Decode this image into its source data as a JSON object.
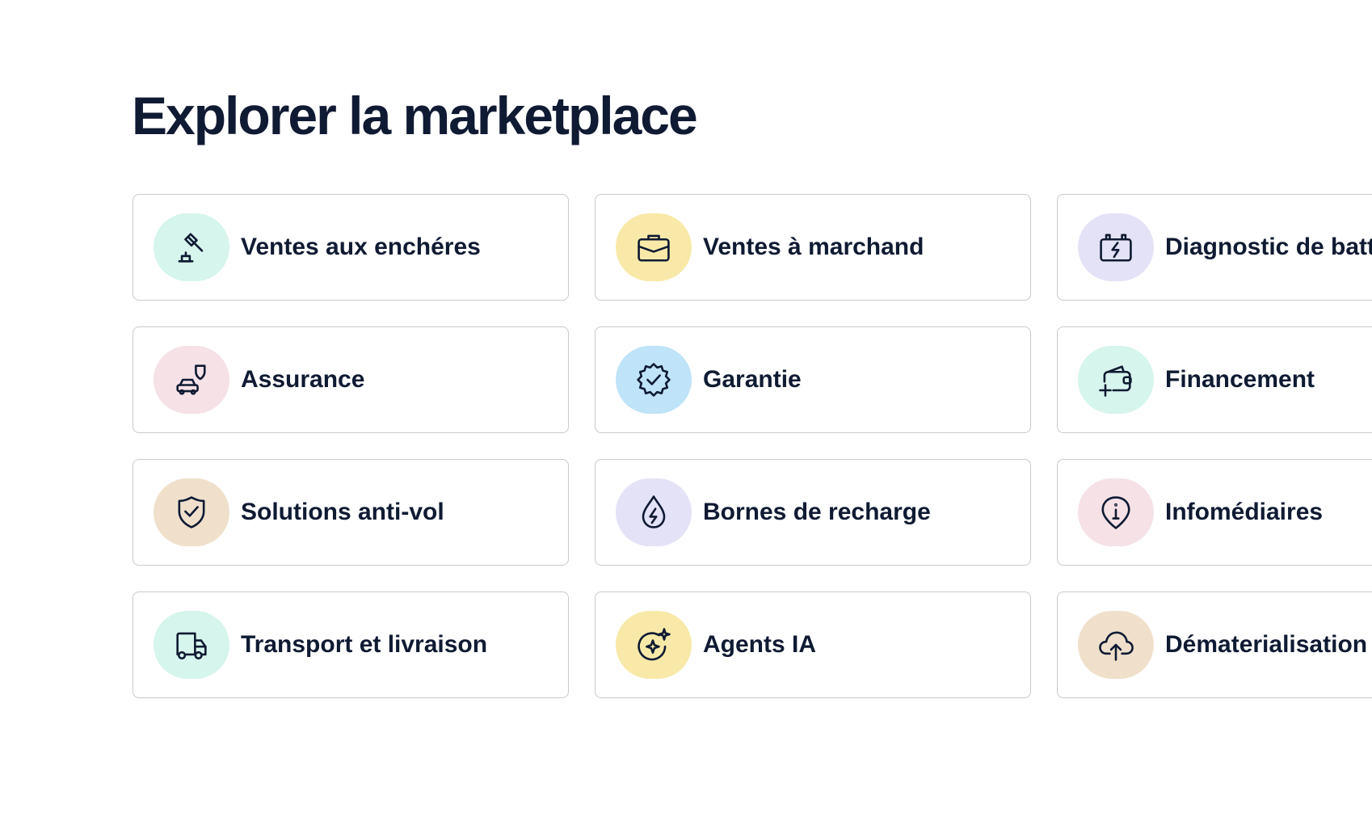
{
  "title": "Explorer la marketplace",
  "cards": [
    {
      "label": "Ventes aux enchéres",
      "icon": "gavel-icon",
      "bg": "#d6f5ec"
    },
    {
      "label": "Ventes à marchand",
      "icon": "briefcase-icon",
      "bg": "#f8e9a8"
    },
    {
      "label": "Diagnostic de batterie",
      "icon": "battery-bolt-icon",
      "bg": "#e4e2f7"
    },
    {
      "label": "Assurance",
      "icon": "car-shield-icon",
      "bg": "#f6e1e6"
    },
    {
      "label": "Garantie",
      "icon": "badge-check-icon",
      "bg": "#bfe3f8"
    },
    {
      "label": "Financement",
      "icon": "wallet-plus-icon",
      "bg": "#d6f5ec"
    },
    {
      "label": "Solutions anti-vol",
      "icon": "shield-check-icon",
      "bg": "#f0e0cb"
    },
    {
      "label": "Bornes de recharge",
      "icon": "drop-bolt-icon",
      "bg": "#e4e2f7"
    },
    {
      "label": "Infomédiaires",
      "icon": "info-pin-icon",
      "bg": "#f6e1e6"
    },
    {
      "label": "Transport et livraison",
      "icon": "truck-icon",
      "bg": "#d6f5ec"
    },
    {
      "label": "Agents IA",
      "icon": "ai-sparkle-icon",
      "bg": "#f8e9a8"
    },
    {
      "label": "Dématerialisation",
      "icon": "cloud-upload-icon",
      "bg": "#f0e0cb"
    }
  ]
}
